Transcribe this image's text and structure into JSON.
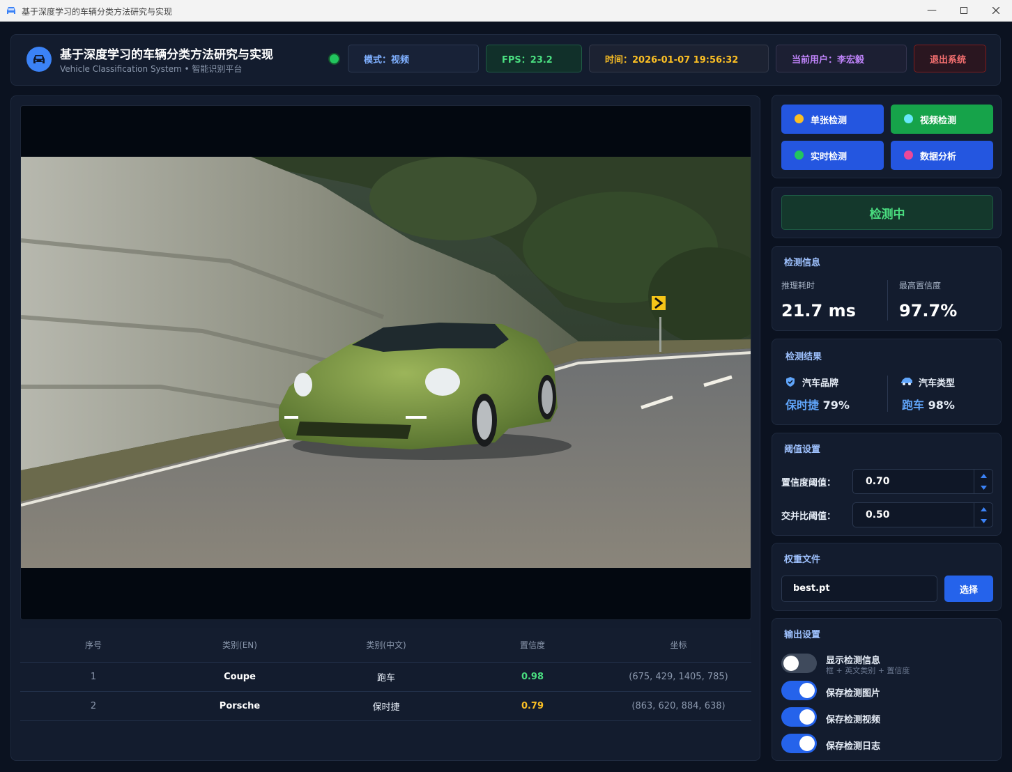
{
  "window": {
    "title": "基于深度学习的车辆分类方法研究与实现"
  },
  "header": {
    "title": "基于深度学习的车辆分类方法研究与实现",
    "subtitle": "Vehicle Classification System • 智能识别平台",
    "mode": "模式：视频",
    "fps": "FPS：23.2",
    "time": "时间：2026-01-07 19:56:32",
    "user": "当前用户：李宏毅",
    "exit": "退出系统"
  },
  "colors": {
    "accent": "#2563eb",
    "success": "#22c55e",
    "warning": "#fbbf24",
    "danger": "#f87171",
    "purple": "#c084fc"
  },
  "table": {
    "headers": [
      "序号",
      "类别(EN)",
      "类别(中文)",
      "置信度",
      "坐标"
    ],
    "rows": [
      {
        "idx": "1",
        "en": "Coupe",
        "cn": "跑车",
        "conf": "0.98",
        "coords": "(675, 429, 1405, 785)"
      },
      {
        "idx": "2",
        "en": "Porsche",
        "cn": "保时捷",
        "conf": "0.79",
        "coords": "(863, 620, 884, 638)"
      }
    ]
  },
  "modes": {
    "single": "单张检测",
    "video": "视频检测",
    "realtime": "实时检测",
    "analysis": "数据分析"
  },
  "status": {
    "label": "检测中"
  },
  "info": {
    "title": "检测信息",
    "latency_label": "推理耗时",
    "latency_value": "21.7 ms",
    "maxconf_label": "最高置信度",
    "maxconf_value": "97.7%"
  },
  "results": {
    "title": "检测结果",
    "brand_label": "汽车品牌",
    "brand_name": "保时捷",
    "brand_conf": "79%",
    "type_label": "汽车类型",
    "type_name": "跑车",
    "type_conf": "98%"
  },
  "threshold": {
    "title": "阈值设置",
    "conf_label": "置信度阈值：",
    "conf_value": "0.70",
    "iou_label": "交并比阈值：",
    "iou_value": "0.50"
  },
  "weights": {
    "title": "权重文件",
    "file": "best.pt",
    "choose": "选择"
  },
  "output": {
    "title": "输出设置",
    "show_info": "显示检测信息",
    "show_info_hint": "框 + 英文类别 + 置信度",
    "save_image": "保存检测图片",
    "save_video": "保存检测视频",
    "save_log": "保存检测日志",
    "toggles": {
      "show_info": false,
      "save_image": true,
      "save_video": true,
      "save_log": true
    }
  }
}
